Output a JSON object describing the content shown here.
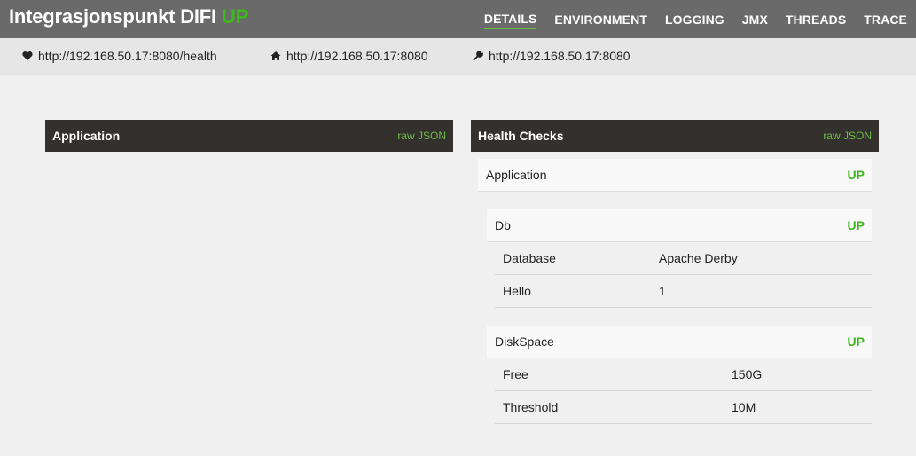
{
  "header": {
    "app_name": "Integrasjonspunkt DIFI",
    "status": "UP",
    "nav": [
      "DETAILS",
      "ENVIRONMENT",
      "LOGGING",
      "JMX",
      "THREADS",
      "TRACE"
    ]
  },
  "urls": {
    "health": "http://192.168.50.17:8080/health",
    "home": "http://192.168.50.17:8080",
    "management": "http://192.168.50.17:8080"
  },
  "application_panel": {
    "title": "Application",
    "raw_json": "raw JSON"
  },
  "health_panel": {
    "title": "Health Checks",
    "raw_json": "raw JSON",
    "application": {
      "label": "Application",
      "status": "UP"
    },
    "db": {
      "label": "Db",
      "status": "UP",
      "details": [
        {
          "key": "Database",
          "value": "Apache Derby"
        },
        {
          "key": "Hello",
          "value": "1"
        }
      ]
    },
    "diskspace": {
      "label": "DiskSpace",
      "status": "UP",
      "details": [
        {
          "key": "Free",
          "value": "150G"
        },
        {
          "key": "Threshold",
          "value": "10M"
        }
      ]
    }
  },
  "colors": {
    "header_bg": "#6a6a6a",
    "panel_header_bg": "#34302d",
    "status_green": "#3cb81d",
    "link_green": "#6dbd45"
  }
}
